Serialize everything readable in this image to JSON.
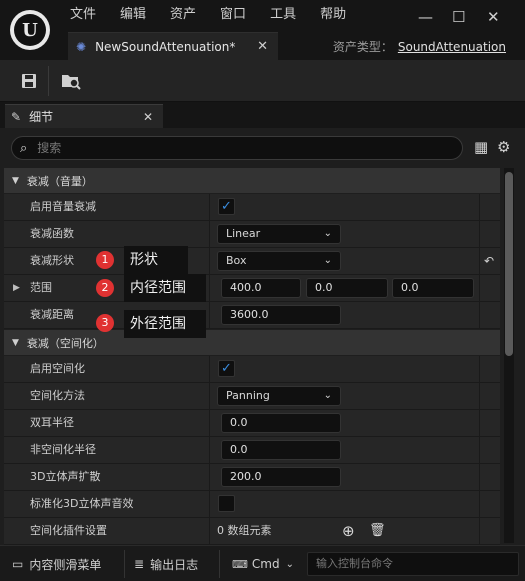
{
  "menu": [
    "文件",
    "编辑",
    "资产",
    "窗口",
    "工具",
    "帮助"
  ],
  "tab": {
    "label": "NewSoundAttenuation*"
  },
  "asset_type": {
    "label": "资产类型：",
    "value": "SoundAttenuation"
  },
  "panel": {
    "label": "细节"
  },
  "search": {
    "placeholder": "搜索"
  },
  "sections": [
    {
      "title": "衰减（音量）"
    },
    {
      "title": "衰减（空间化）"
    }
  ],
  "rows": {
    "enable_volume_atten": {
      "label": "启用音量衰减"
    },
    "atten_function": {
      "label": "衰减函数",
      "value": "Linear"
    },
    "atten_shape": {
      "label": "衰减形状",
      "value": "Box"
    },
    "extents": {
      "label": "范围",
      "x": "400.0",
      "y": "0.0",
      "z": "0.0"
    },
    "falloff_distance": {
      "label": "衰减距离",
      "value": "3600.0"
    },
    "enable_spatialization": {
      "label": "启用空间化"
    },
    "spatialization_method": {
      "label": "空间化方法",
      "value": "Panning"
    },
    "binaural_radius": {
      "label": "双耳半径",
      "value": "0.0"
    },
    "non_spatialized_radius": {
      "label": "非空间化半径",
      "value": "0.0"
    },
    "stereo_spread": {
      "label": "3D立体声扩散",
      "value": "200.0"
    },
    "normalize_3d_stereo": {
      "label": "标准化3D立体声音效"
    },
    "spatialization_plugin": {
      "label": "空间化插件设置",
      "value": "0 数组元素"
    }
  },
  "callouts": [
    {
      "num": "1",
      "text": "形状"
    },
    {
      "num": "2",
      "text": "内径范围"
    },
    {
      "num": "3",
      "text": "外径范围"
    }
  ],
  "statusbar": {
    "content_drawer": "内容侧滑菜单",
    "output_log": "输出日志",
    "cmd": "Cmd",
    "console_placeholder": "输入控制台命令"
  },
  "colors": {
    "accent": "#3a8de0",
    "badge": "#e03232"
  }
}
